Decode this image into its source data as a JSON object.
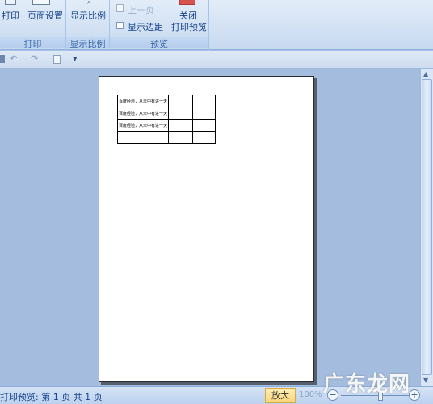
{
  "ribbon": {
    "print_group": {
      "label": "打印",
      "print_label": "打印",
      "page_setup_label": "页面设置"
    },
    "zoom_group": {
      "label": "显示比例",
      "zoom_label": "显示比例"
    },
    "preview_group": {
      "label": "预览",
      "prev_page_label": "上一页",
      "show_margins_label": "显示边距",
      "close_label_line1": "关闭",
      "close_label_line2": "打印预览"
    }
  },
  "qat": {
    "undo": "↶",
    "redo": "↷",
    "more": "▾"
  },
  "sheet": {
    "rows": [
      [
        "百度经验，从未中有进一天",
        "",
        ""
      ],
      [
        "百度经验，从未中有进一天",
        "",
        ""
      ],
      [
        "百度经验，从未中有进一天",
        "",
        ""
      ],
      [
        "",
        "",
        ""
      ]
    ]
  },
  "status": {
    "text": "打印预览: 第 1 页  共 1 页",
    "zoom_button": "放大",
    "zoom_level": "100%"
  },
  "watermark": "广东龙网",
  "colors": {
    "ribbon_bg": "#d6e4f5",
    "workspace_bg": "#a4bddf",
    "accent_text": "#15428b",
    "close_icon": "#d9534f"
  }
}
